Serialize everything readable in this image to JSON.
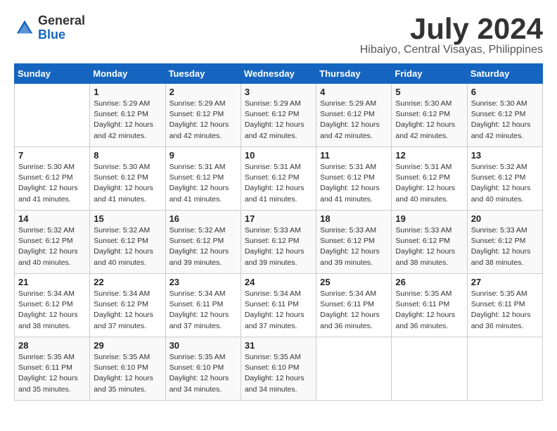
{
  "header": {
    "logo_general": "General",
    "logo_blue": "Blue",
    "month_title": "July 2024",
    "location": "Hibaiyo, Central Visayas, Philippines"
  },
  "weekdays": [
    "Sunday",
    "Monday",
    "Tuesday",
    "Wednesday",
    "Thursday",
    "Friday",
    "Saturday"
  ],
  "weeks": [
    [
      {
        "num": "",
        "sunrise": "",
        "sunset": "",
        "daylight": ""
      },
      {
        "num": "1",
        "sunrise": "Sunrise: 5:29 AM",
        "sunset": "Sunset: 6:12 PM",
        "daylight": "Daylight: 12 hours and 42 minutes."
      },
      {
        "num": "2",
        "sunrise": "Sunrise: 5:29 AM",
        "sunset": "Sunset: 6:12 PM",
        "daylight": "Daylight: 12 hours and 42 minutes."
      },
      {
        "num": "3",
        "sunrise": "Sunrise: 5:29 AM",
        "sunset": "Sunset: 6:12 PM",
        "daylight": "Daylight: 12 hours and 42 minutes."
      },
      {
        "num": "4",
        "sunrise": "Sunrise: 5:29 AM",
        "sunset": "Sunset: 6:12 PM",
        "daylight": "Daylight: 12 hours and 42 minutes."
      },
      {
        "num": "5",
        "sunrise": "Sunrise: 5:30 AM",
        "sunset": "Sunset: 6:12 PM",
        "daylight": "Daylight: 12 hours and 42 minutes."
      },
      {
        "num": "6",
        "sunrise": "Sunrise: 5:30 AM",
        "sunset": "Sunset: 6:12 PM",
        "daylight": "Daylight: 12 hours and 42 minutes."
      }
    ],
    [
      {
        "num": "7",
        "sunrise": "Sunrise: 5:30 AM",
        "sunset": "Sunset: 6:12 PM",
        "daylight": "Daylight: 12 hours and 41 minutes."
      },
      {
        "num": "8",
        "sunrise": "Sunrise: 5:30 AM",
        "sunset": "Sunset: 6:12 PM",
        "daylight": "Daylight: 12 hours and 41 minutes."
      },
      {
        "num": "9",
        "sunrise": "Sunrise: 5:31 AM",
        "sunset": "Sunset: 6:12 PM",
        "daylight": "Daylight: 12 hours and 41 minutes."
      },
      {
        "num": "10",
        "sunrise": "Sunrise: 5:31 AM",
        "sunset": "Sunset: 6:12 PM",
        "daylight": "Daylight: 12 hours and 41 minutes."
      },
      {
        "num": "11",
        "sunrise": "Sunrise: 5:31 AM",
        "sunset": "Sunset: 6:12 PM",
        "daylight": "Daylight: 12 hours and 41 minutes."
      },
      {
        "num": "12",
        "sunrise": "Sunrise: 5:31 AM",
        "sunset": "Sunset: 6:12 PM",
        "daylight": "Daylight: 12 hours and 40 minutes."
      },
      {
        "num": "13",
        "sunrise": "Sunrise: 5:32 AM",
        "sunset": "Sunset: 6:12 PM",
        "daylight": "Daylight: 12 hours and 40 minutes."
      }
    ],
    [
      {
        "num": "14",
        "sunrise": "Sunrise: 5:32 AM",
        "sunset": "Sunset: 6:12 PM",
        "daylight": "Daylight: 12 hours and 40 minutes."
      },
      {
        "num": "15",
        "sunrise": "Sunrise: 5:32 AM",
        "sunset": "Sunset: 6:12 PM",
        "daylight": "Daylight: 12 hours and 40 minutes."
      },
      {
        "num": "16",
        "sunrise": "Sunrise: 5:32 AM",
        "sunset": "Sunset: 6:12 PM",
        "daylight": "Daylight: 12 hours and 39 minutes."
      },
      {
        "num": "17",
        "sunrise": "Sunrise: 5:33 AM",
        "sunset": "Sunset: 6:12 PM",
        "daylight": "Daylight: 12 hours and 39 minutes."
      },
      {
        "num": "18",
        "sunrise": "Sunrise: 5:33 AM",
        "sunset": "Sunset: 6:12 PM",
        "daylight": "Daylight: 12 hours and 39 minutes."
      },
      {
        "num": "19",
        "sunrise": "Sunrise: 5:33 AM",
        "sunset": "Sunset: 6:12 PM",
        "daylight": "Daylight: 12 hours and 38 minutes."
      },
      {
        "num": "20",
        "sunrise": "Sunrise: 5:33 AM",
        "sunset": "Sunset: 6:12 PM",
        "daylight": "Daylight: 12 hours and 38 minutes."
      }
    ],
    [
      {
        "num": "21",
        "sunrise": "Sunrise: 5:34 AM",
        "sunset": "Sunset: 6:12 PM",
        "daylight": "Daylight: 12 hours and 38 minutes."
      },
      {
        "num": "22",
        "sunrise": "Sunrise: 5:34 AM",
        "sunset": "Sunset: 6:12 PM",
        "daylight": "Daylight: 12 hours and 37 minutes."
      },
      {
        "num": "23",
        "sunrise": "Sunrise: 5:34 AM",
        "sunset": "Sunset: 6:11 PM",
        "daylight": "Daylight: 12 hours and 37 minutes."
      },
      {
        "num": "24",
        "sunrise": "Sunrise: 5:34 AM",
        "sunset": "Sunset: 6:11 PM",
        "daylight": "Daylight: 12 hours and 37 minutes."
      },
      {
        "num": "25",
        "sunrise": "Sunrise: 5:34 AM",
        "sunset": "Sunset: 6:11 PM",
        "daylight": "Daylight: 12 hours and 36 minutes."
      },
      {
        "num": "26",
        "sunrise": "Sunrise: 5:35 AM",
        "sunset": "Sunset: 6:11 PM",
        "daylight": "Daylight: 12 hours and 36 minutes."
      },
      {
        "num": "27",
        "sunrise": "Sunrise: 5:35 AM",
        "sunset": "Sunset: 6:11 PM",
        "daylight": "Daylight: 12 hours and 36 minutes."
      }
    ],
    [
      {
        "num": "28",
        "sunrise": "Sunrise: 5:35 AM",
        "sunset": "Sunset: 6:11 PM",
        "daylight": "Daylight: 12 hours and 35 minutes."
      },
      {
        "num": "29",
        "sunrise": "Sunrise: 5:35 AM",
        "sunset": "Sunset: 6:10 PM",
        "daylight": "Daylight: 12 hours and 35 minutes."
      },
      {
        "num": "30",
        "sunrise": "Sunrise: 5:35 AM",
        "sunset": "Sunset: 6:10 PM",
        "daylight": "Daylight: 12 hours and 34 minutes."
      },
      {
        "num": "31",
        "sunrise": "Sunrise: 5:35 AM",
        "sunset": "Sunset: 6:10 PM",
        "daylight": "Daylight: 12 hours and 34 minutes."
      },
      {
        "num": "",
        "sunrise": "",
        "sunset": "",
        "daylight": ""
      },
      {
        "num": "",
        "sunrise": "",
        "sunset": "",
        "daylight": ""
      },
      {
        "num": "",
        "sunrise": "",
        "sunset": "",
        "daylight": ""
      }
    ]
  ]
}
